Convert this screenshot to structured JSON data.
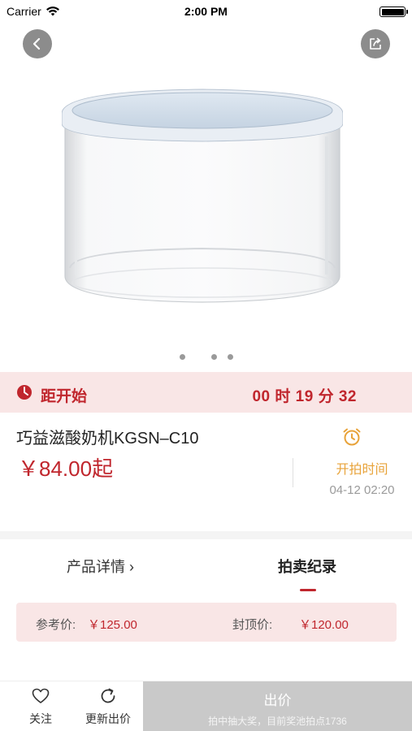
{
  "status_bar": {
    "carrier": "Carrier",
    "time": "2:00 PM"
  },
  "hero": {
    "page_indicator_count": 3,
    "active_page": 1
  },
  "countdown": {
    "label": "距开始",
    "timer": "00 时 19 分 32"
  },
  "product": {
    "name": "巧益滋酸奶机KGSN–C10",
    "price": "￥84.00起",
    "start_label": "开拍时间",
    "start_time": "04-12 02:20"
  },
  "tabs": [
    {
      "label": "产品详情 ›",
      "selected": false
    },
    {
      "label": "拍卖纪录",
      "selected": true
    }
  ],
  "prices": {
    "ref_label": "参考价:",
    "ref_value": "￥125.00",
    "cap_label": "封顶价:",
    "cap_value": "￥120.00"
  },
  "bottom_bar": {
    "follow_label": "关注",
    "refresh_label": "更新出价",
    "bid_label": "出价",
    "bid_sub": "拍中抽大奖，目前奖池拍点1736"
  },
  "colors": {
    "accent_red": "#c0262d",
    "countdown_bg": "#f9e6e6",
    "alarm_orange": "#e8a33a",
    "disabled_button": "#c9c9c9"
  }
}
